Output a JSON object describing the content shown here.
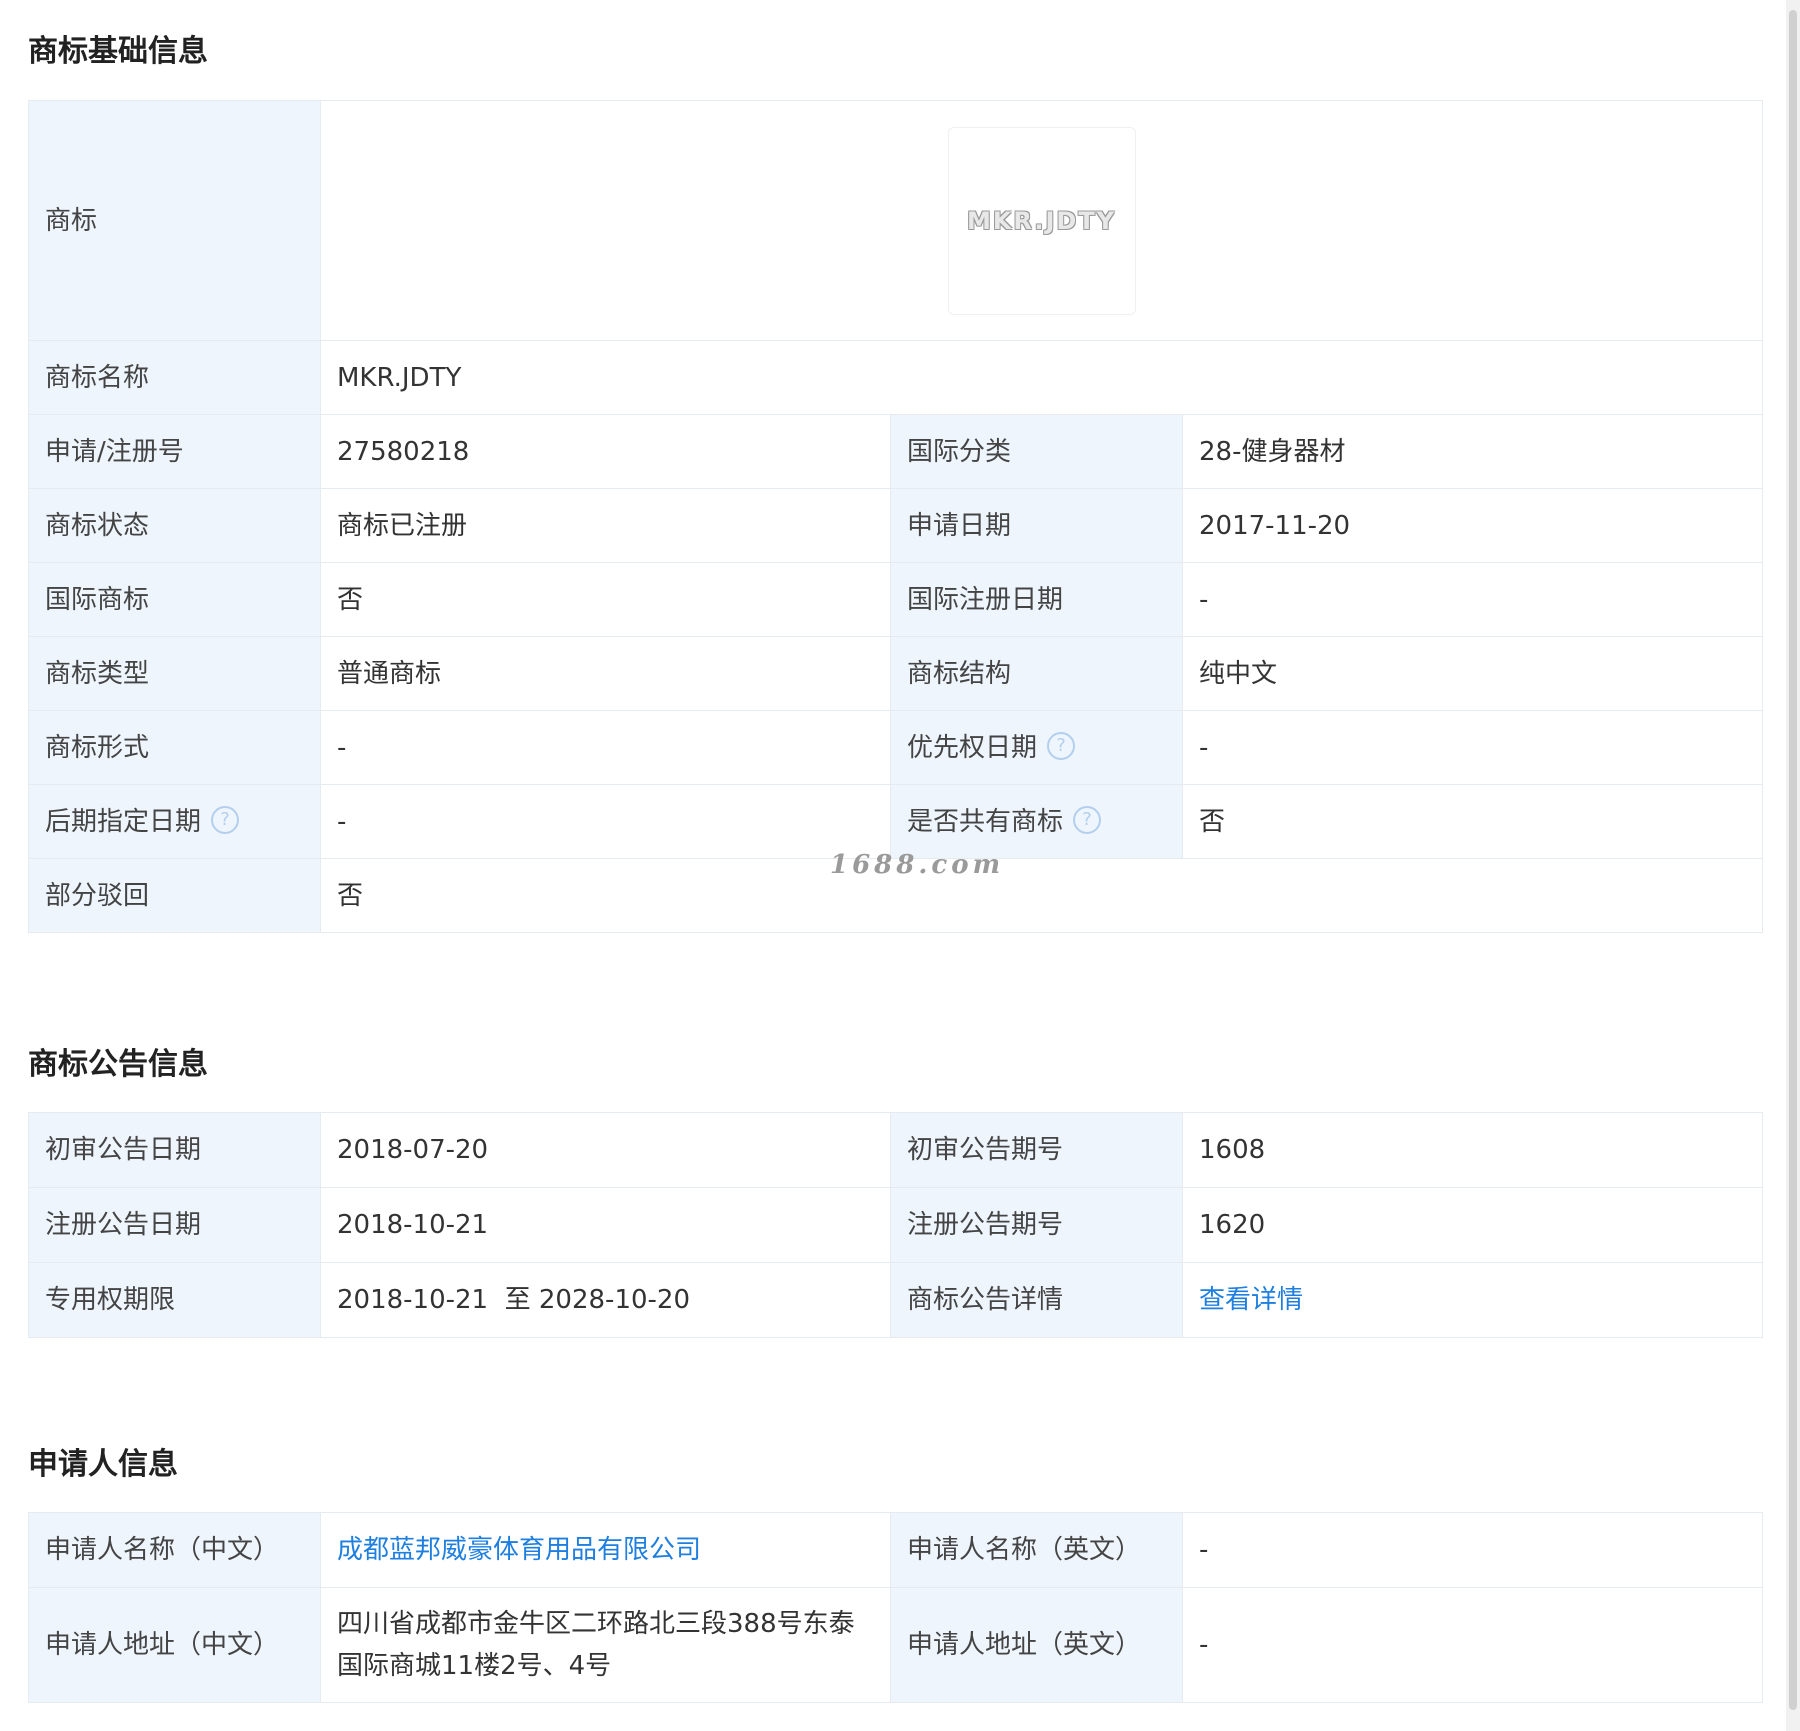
{
  "basic": {
    "title": "商标基础信息",
    "logo_label": "商标",
    "logo_text": "MKR.JDTY",
    "name_label": "商标名称",
    "name_value": "MKR.JDTY",
    "reg_no_label": "申请/注册号",
    "reg_no_value": "27580218",
    "intl_class_label": "国际分类",
    "intl_class_value": "28-健身器材",
    "status_label": "商标状态",
    "status_value": "商标已注册",
    "apply_date_label": "申请日期",
    "apply_date_value": "2017-11-20",
    "intl_tm_label": "国际商标",
    "intl_tm_value": "否",
    "intl_reg_date_label": "国际注册日期",
    "intl_reg_date_value": "-",
    "type_label": "商标类型",
    "type_value": "普通商标",
    "structure_label": "商标结构",
    "structure_value": "纯中文",
    "form_label": "商标形式",
    "form_value": "-",
    "priority_label": "优先权日期",
    "priority_value": "-",
    "later_designation_label": "后期指定日期",
    "later_designation_value": "-",
    "shared_label": "是否共有商标",
    "shared_value": "否",
    "partial_reject_label": "部分驳回",
    "partial_reject_value": "否",
    "help_glyph": "?"
  },
  "announcement": {
    "title": "商标公告信息",
    "prelim_date_label": "初审公告日期",
    "prelim_date_value": "2018-07-20",
    "prelim_issue_label": "初审公告期号",
    "prelim_issue_value": "1608",
    "reg_date_label": "注册公告日期",
    "reg_date_value": "2018-10-21",
    "reg_issue_label": "注册公告期号",
    "reg_issue_value": "1620",
    "term_label": "专用权期限",
    "term_value": "2018-10-21  至 2028-10-20",
    "detail_label": "商标公告详情",
    "detail_link": "查看详情"
  },
  "applicant": {
    "title": "申请人信息",
    "name_cn_label": "申请人名称（中文）",
    "name_cn_value": "成都蓝邦威豪体育用品有限公司",
    "name_en_label": "申请人名称（英文）",
    "name_en_value": "-",
    "addr_cn_label": "申请人地址（中文）",
    "addr_cn_value": "四川省成都市金牛区二环路北三段388号东泰国际商城11楼2号、4号",
    "addr_en_label": "申请人地址（英文）",
    "addr_en_value": "-"
  },
  "watermark": "1688.com",
  "colors": {
    "label_bg": "#eef5fd",
    "border": "#e6ebf0",
    "link": "#1e7fe0"
  }
}
